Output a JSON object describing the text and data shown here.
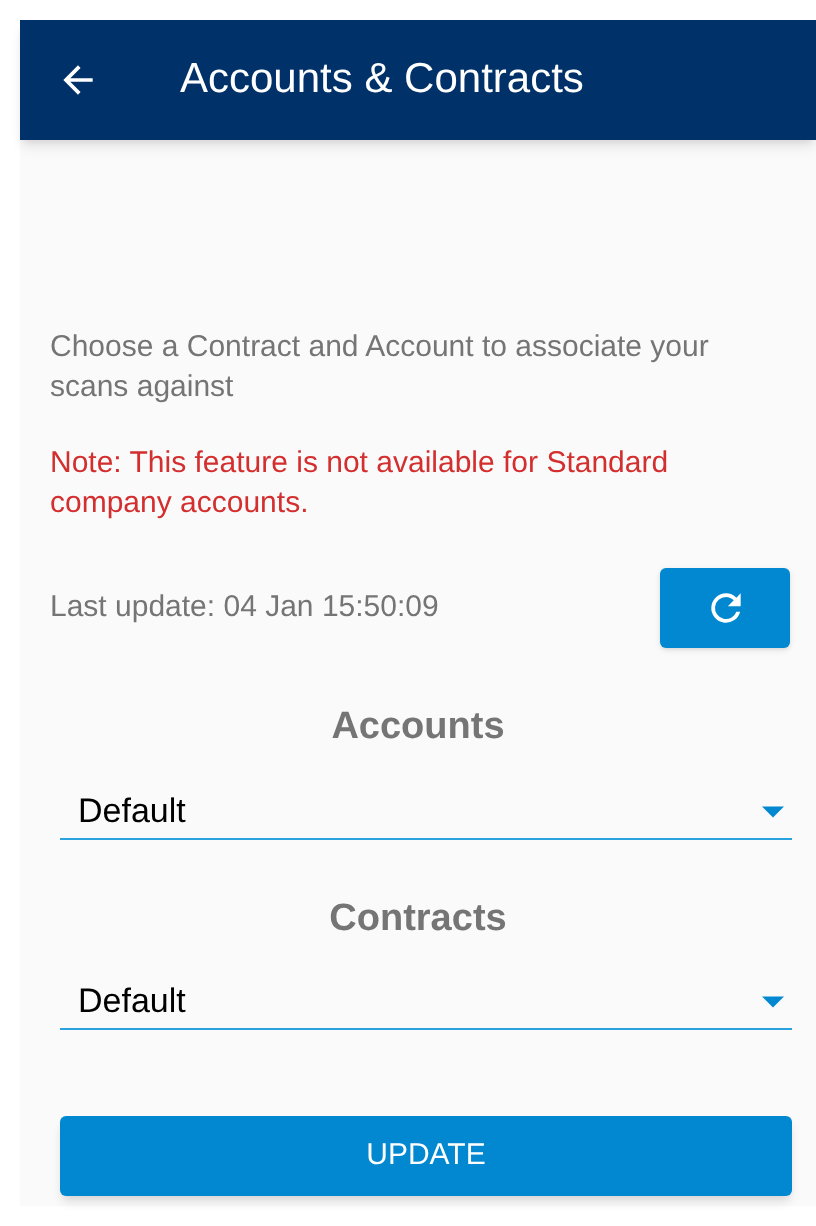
{
  "app_bar": {
    "title": "Accounts & Contracts"
  },
  "intro": "Choose a Contract and Account to associate your scans against",
  "note": "Note: This feature is not available for Standard company accounts.",
  "last_update": "Last update: 04 Jan 15:50:09",
  "selects": [
    {
      "label": "Accounts",
      "value": "Default"
    },
    {
      "label": "Contracts",
      "value": "Default"
    }
  ],
  "update_button": "UPDATE"
}
